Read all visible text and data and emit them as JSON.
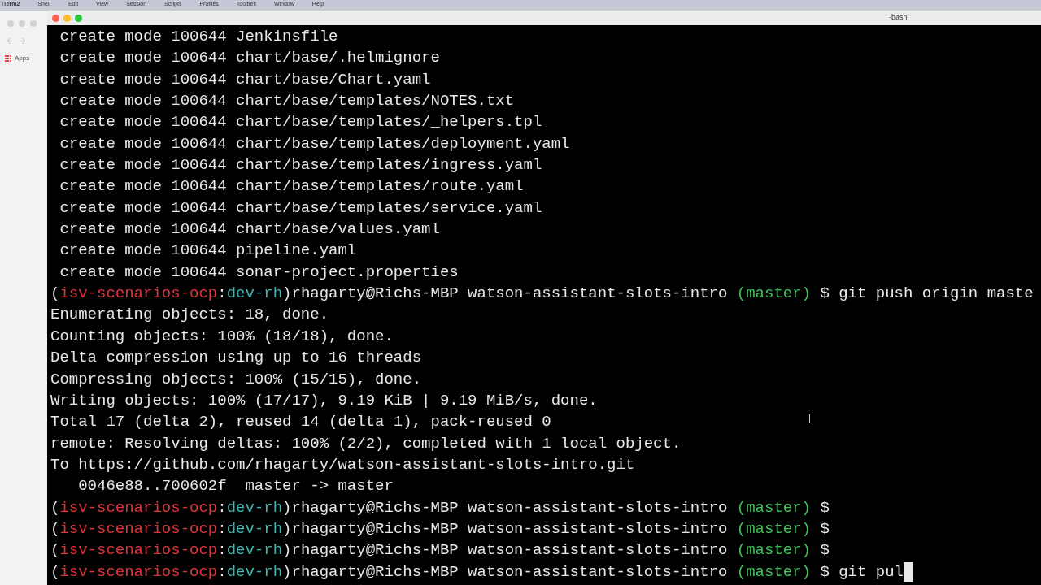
{
  "menu_bar": {
    "items": [
      "iTerm2",
      "Shell",
      "Edit",
      "View",
      "Session",
      "Scripts",
      "Profiles",
      "Toolbelt",
      "Window",
      "Help"
    ]
  },
  "background_browser": {
    "bookmark": "Apps"
  },
  "terminal": {
    "title": "-bash",
    "lines": [
      {
        "kind": "output",
        "text": " create mode 100644 Jenkinsfile"
      },
      {
        "kind": "output",
        "text": " create mode 100644 chart/base/.helmignore"
      },
      {
        "kind": "output",
        "text": " create mode 100644 chart/base/Chart.yaml"
      },
      {
        "kind": "output",
        "text": " create mode 100644 chart/base/templates/NOTES.txt"
      },
      {
        "kind": "output",
        "text": " create mode 100644 chart/base/templates/_helpers.tpl"
      },
      {
        "kind": "output",
        "text": " create mode 100644 chart/base/templates/deployment.yaml"
      },
      {
        "kind": "output",
        "text": " create mode 100644 chart/base/templates/ingress.yaml"
      },
      {
        "kind": "output",
        "text": " create mode 100644 chart/base/templates/route.yaml"
      },
      {
        "kind": "output",
        "text": " create mode 100644 chart/base/templates/service.yaml"
      },
      {
        "kind": "output",
        "text": " create mode 100644 chart/base/values.yaml"
      },
      {
        "kind": "output",
        "text": " create mode 100644 pipeline.yaml"
      },
      {
        "kind": "output",
        "text": " create mode 100644 sonar-project.properties"
      },
      {
        "kind": "prompt",
        "segments": [
          {
            "text": "(",
            "color": "#e8e8e8"
          },
          {
            "text": "isv-scenarios-ocp",
            "color": "#e0343a"
          },
          {
            "text": ":",
            "color": "#e8e8e8"
          },
          {
            "text": "dev-rh",
            "color": "#3fb6b0"
          },
          {
            "text": ")rhagarty@Richs-MBP watson-assistant-slots-intro ",
            "color": "#e8e8e8"
          },
          {
            "text": "(master)",
            "color": "#3fc25a"
          },
          {
            "text": " $ git push origin maste",
            "color": "#e8e8e8"
          }
        ]
      },
      {
        "kind": "output",
        "text": "Enumerating objects: 18, done."
      },
      {
        "kind": "output",
        "text": "Counting objects: 100% (18/18), done."
      },
      {
        "kind": "output",
        "text": "Delta compression using up to 16 threads"
      },
      {
        "kind": "output",
        "text": "Compressing objects: 100% (15/15), done."
      },
      {
        "kind": "output",
        "text": "Writing objects: 100% (17/17), 9.19 KiB | 9.19 MiB/s, done."
      },
      {
        "kind": "output",
        "text": "Total 17 (delta 2), reused 14 (delta 1), pack-reused 0"
      },
      {
        "kind": "output",
        "text": "remote: Resolving deltas: 100% (2/2), completed with 1 local object."
      },
      {
        "kind": "output",
        "text": "To https://github.com/rhagarty/watson-assistant-slots-intro.git"
      },
      {
        "kind": "output",
        "text": "   0046e88..700602f  master -> master"
      },
      {
        "kind": "prompt",
        "segments": [
          {
            "text": "(",
            "color": "#e8e8e8"
          },
          {
            "text": "isv-scenarios-ocp",
            "color": "#e0343a"
          },
          {
            "text": ":",
            "color": "#e8e8e8"
          },
          {
            "text": "dev-rh",
            "color": "#3fb6b0"
          },
          {
            "text": ")rhagarty@Richs-MBP watson-assistant-slots-intro ",
            "color": "#e8e8e8"
          },
          {
            "text": "(master)",
            "color": "#3fc25a"
          },
          {
            "text": " $",
            "color": "#e8e8e8"
          }
        ]
      },
      {
        "kind": "prompt",
        "segments": [
          {
            "text": "(",
            "color": "#e8e8e8"
          },
          {
            "text": "isv-scenarios-ocp",
            "color": "#e0343a"
          },
          {
            "text": ":",
            "color": "#e8e8e8"
          },
          {
            "text": "dev-rh",
            "color": "#3fb6b0"
          },
          {
            "text": ")rhagarty@Richs-MBP watson-assistant-slots-intro ",
            "color": "#e8e8e8"
          },
          {
            "text": "(master)",
            "color": "#3fc25a"
          },
          {
            "text": " $",
            "color": "#e8e8e8"
          }
        ]
      },
      {
        "kind": "prompt",
        "segments": [
          {
            "text": "(",
            "color": "#e8e8e8"
          },
          {
            "text": "isv-scenarios-ocp",
            "color": "#e0343a"
          },
          {
            "text": ":",
            "color": "#e8e8e8"
          },
          {
            "text": "dev-rh",
            "color": "#3fb6b0"
          },
          {
            "text": ")rhagarty@Richs-MBP watson-assistant-slots-intro ",
            "color": "#e8e8e8"
          },
          {
            "text": "(master)",
            "color": "#3fc25a"
          },
          {
            "text": " $",
            "color": "#e8e8e8"
          }
        ]
      },
      {
        "kind": "prompt",
        "cursor": true,
        "segments": [
          {
            "text": "(",
            "color": "#e8e8e8"
          },
          {
            "text": "isv-scenarios-ocp",
            "color": "#e0343a"
          },
          {
            "text": ":",
            "color": "#e8e8e8"
          },
          {
            "text": "dev-rh",
            "color": "#3fb6b0"
          },
          {
            "text": ")rhagarty@Richs-MBP watson-assistant-slots-intro ",
            "color": "#e8e8e8"
          },
          {
            "text": "(master)",
            "color": "#3fc25a"
          },
          {
            "text": " $ git pul",
            "color": "#e8e8e8"
          }
        ]
      }
    ]
  }
}
